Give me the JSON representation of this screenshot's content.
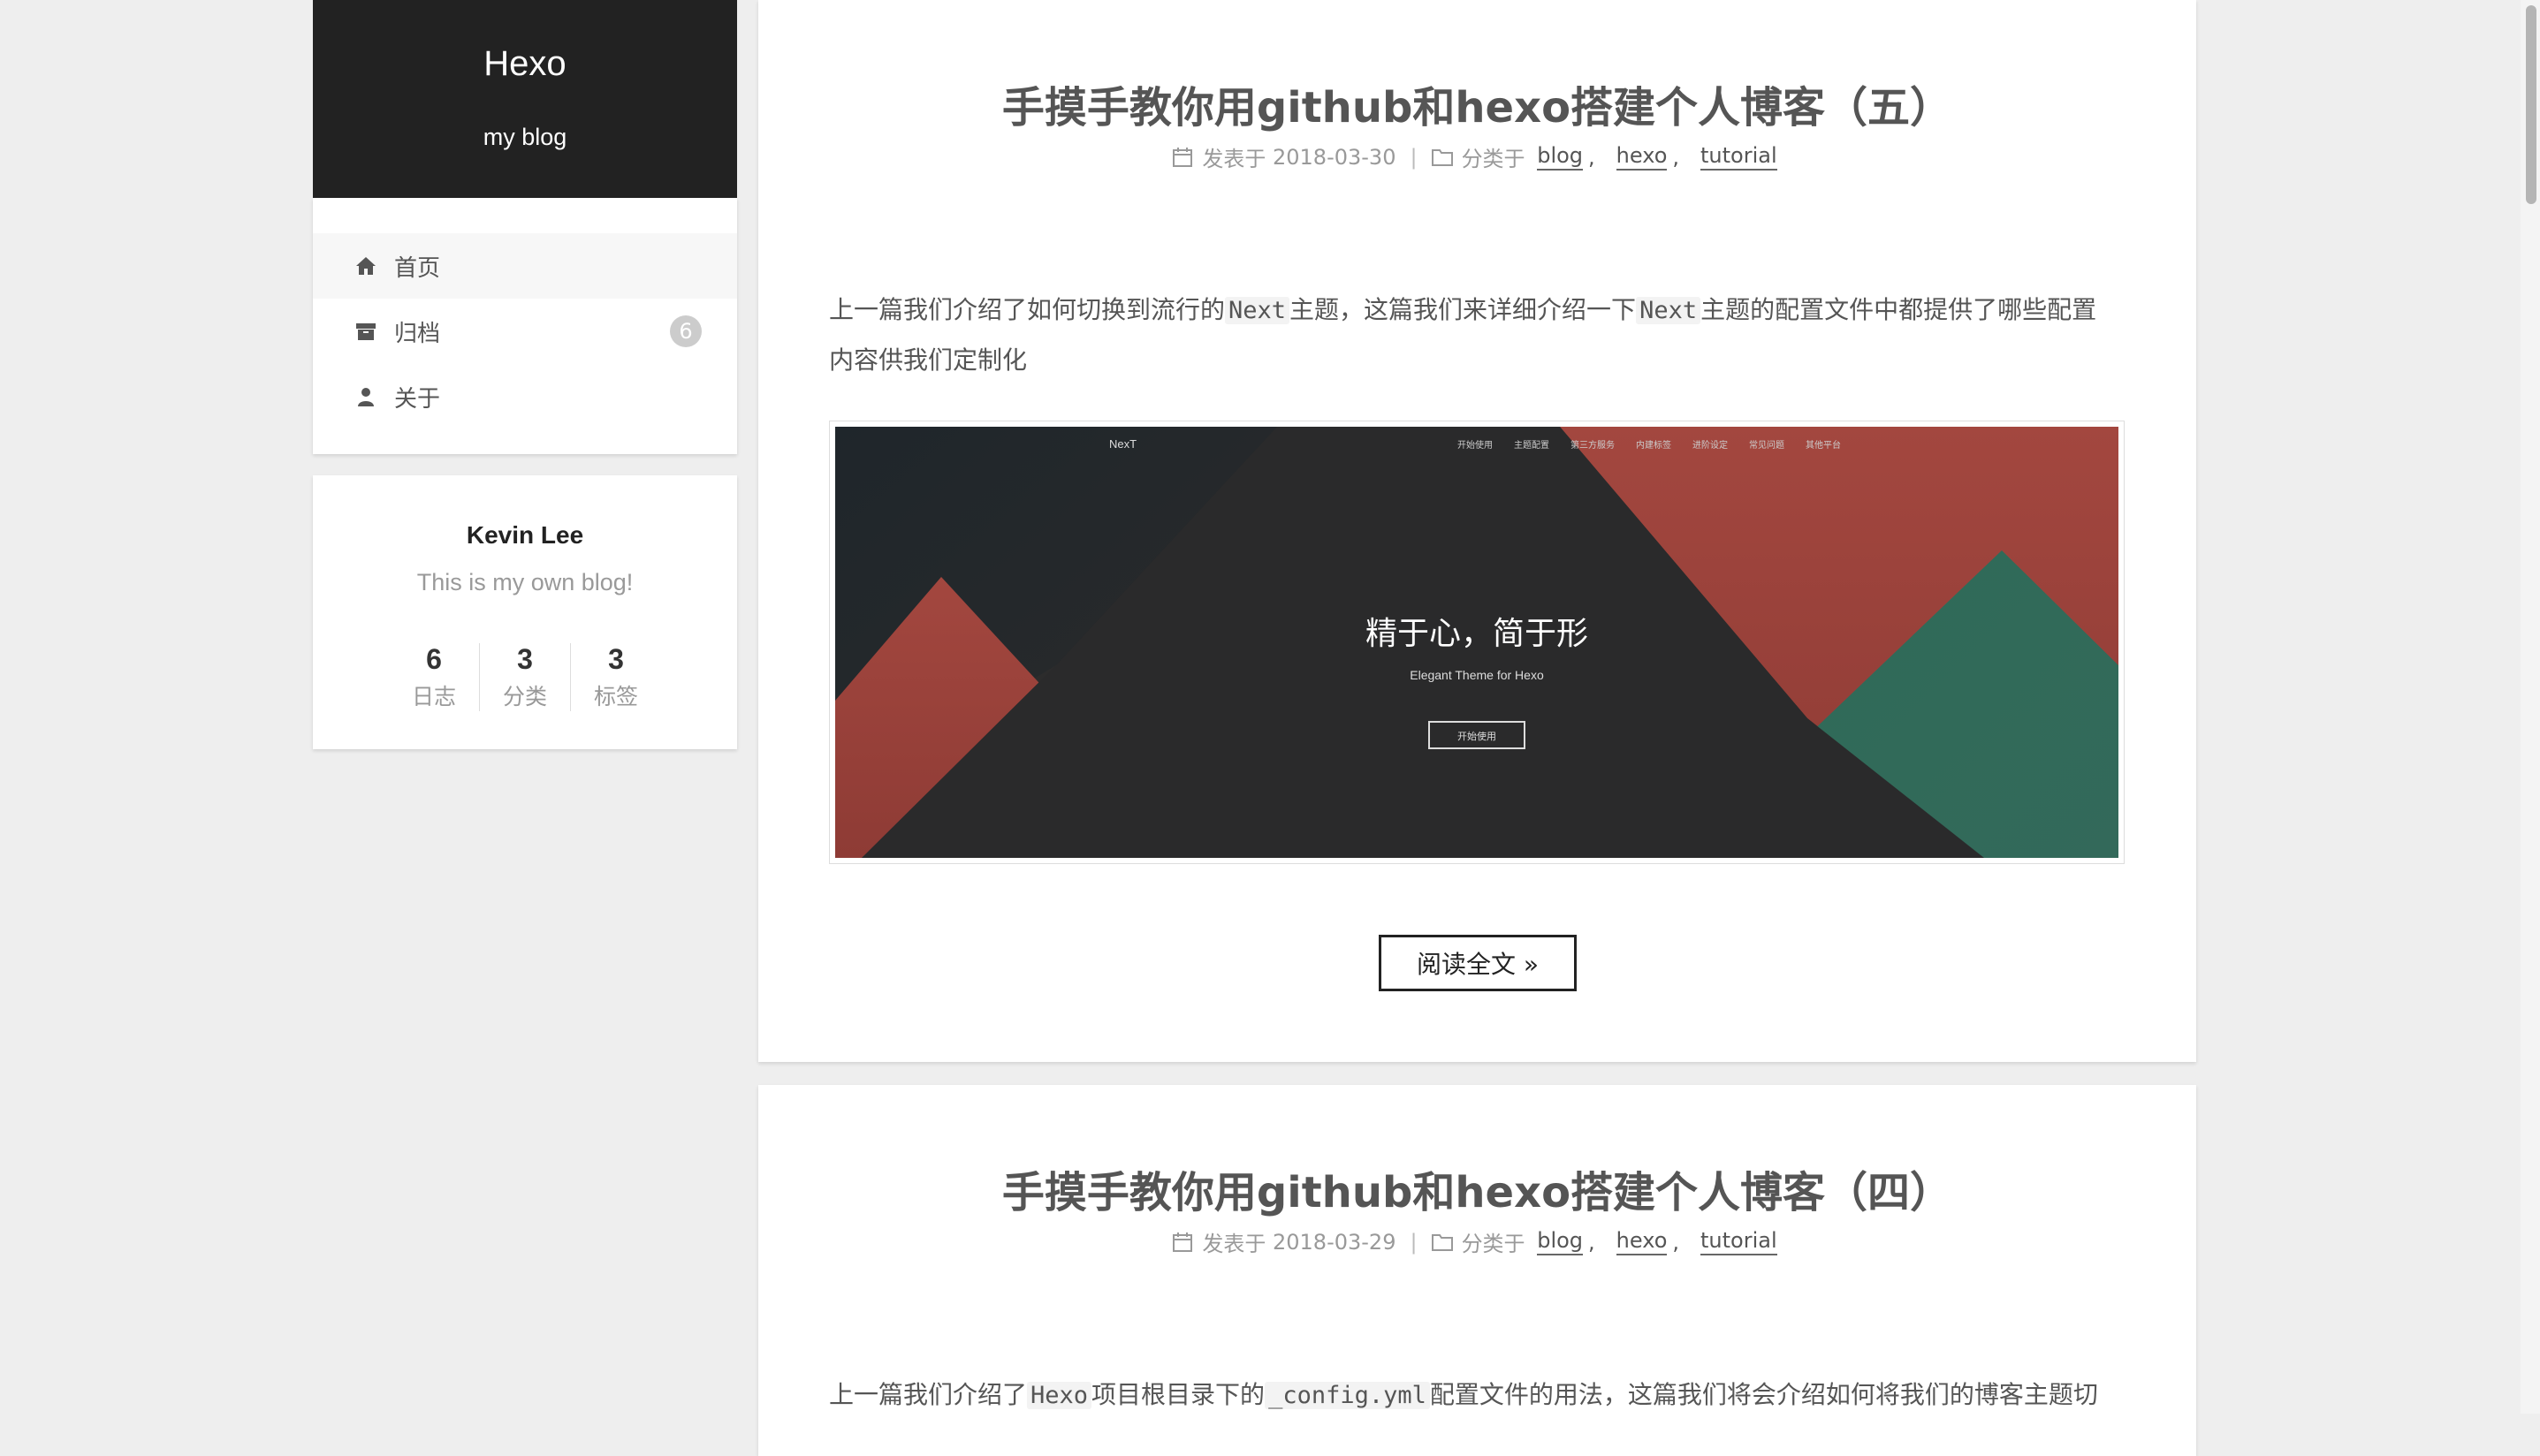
{
  "site": {
    "title": "Hexo",
    "subtitle": "my blog"
  },
  "menu": {
    "items": [
      {
        "label": "首页",
        "icon": "home-icon",
        "active": true
      },
      {
        "label": "归档",
        "icon": "archive-icon",
        "badge": "6"
      },
      {
        "label": "关于",
        "icon": "user-icon"
      }
    ]
  },
  "profile": {
    "name": "Kevin Lee",
    "description": "This is my own blog!",
    "stats": [
      {
        "count": "6",
        "label": "日志"
      },
      {
        "count": "3",
        "label": "分类"
      },
      {
        "count": "3",
        "label": "标签"
      }
    ]
  },
  "posts": [
    {
      "title": "手摸手教你用github和hexo搭建个人博客（五）",
      "posted_prefix": "发表于",
      "date": "2018-03-30",
      "category_prefix": "分类于",
      "categories": [
        "blog",
        "hexo",
        "tutorial"
      ],
      "body_parts": [
        "上一篇我们介绍了如何切换到流行的",
        "Next",
        "主题，这篇我们来详细介绍一下",
        "Next",
        "主题的配置文件中都提供了哪些配置",
        "内容供我们定制化"
      ],
      "image": {
        "brand": "NexT",
        "nav": [
          "开始使用",
          "主题配置",
          "第三方服务",
          "内建标签",
          "进阶设定",
          "常见问题",
          "其他平台"
        ],
        "headline": "精于心，简于形",
        "tagline": "Elegant Theme for Hexo",
        "button": "开始使用"
      },
      "read_more": "阅读全文 »"
    },
    {
      "title": "手摸手教你用github和hexo搭建个人博客（四）",
      "posted_prefix": "发表于",
      "date": "2018-03-29",
      "category_prefix": "分类于",
      "categories": [
        "blog",
        "hexo",
        "tutorial"
      ],
      "body_parts": [
        "上一篇我们介绍了",
        "Hexo",
        "项目根目录下的",
        "_config.yml",
        "配置文件的用法，这篇我们将会介绍如何将我们的博客主题切"
      ]
    }
  ],
  "colors": {
    "header_bg": "#222222",
    "page_bg": "#eeeeee",
    "banner_dark": "#2b2b2b",
    "banner_red": "#a0453f",
    "banner_green": "#2f6b58"
  }
}
